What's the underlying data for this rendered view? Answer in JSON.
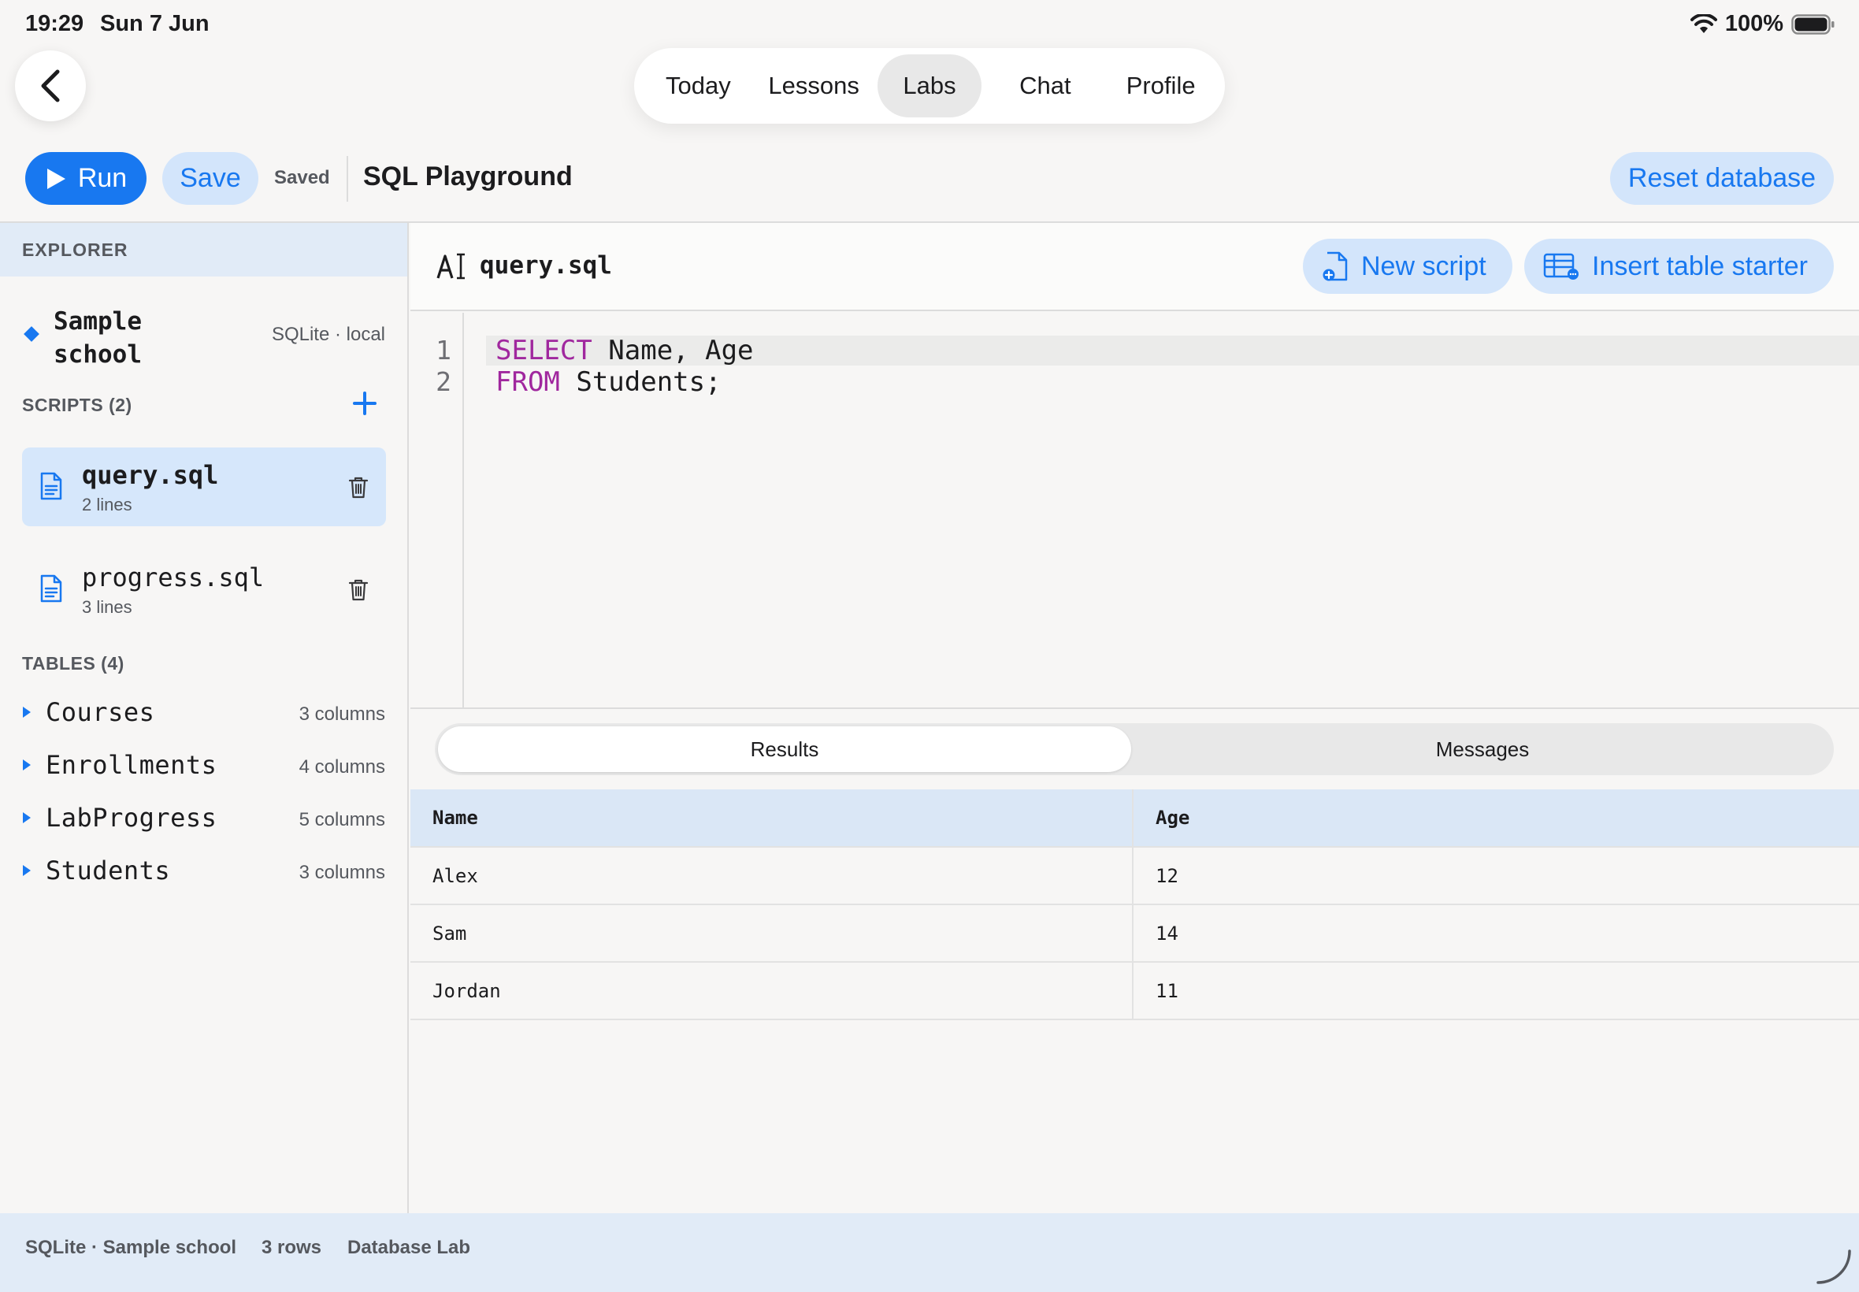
{
  "status_bar": {
    "time": "19:29",
    "date": "Sun 7 Jun",
    "battery": "100%"
  },
  "nav": {
    "tabs": [
      {
        "label": "Today"
      },
      {
        "label": "Lessons"
      },
      {
        "label": "Labs"
      },
      {
        "label": "Chat"
      },
      {
        "label": "Profile"
      }
    ],
    "active_tab": "Labs"
  },
  "toolbar": {
    "run_label": "Run",
    "save_label": "Save",
    "saved_status": "Saved",
    "title": "SQL Playground",
    "reset_label": "Reset database"
  },
  "sidebar": {
    "explorer_label": "EXPLORER",
    "database": {
      "name": "Sample school",
      "meta": "SQLite · local"
    },
    "scripts_label": "SCRIPTS (2)",
    "scripts": [
      {
        "name": "query.sql",
        "lines": "2 lines"
      },
      {
        "name": "progress.sql",
        "lines": "3 lines"
      }
    ],
    "active_script": "query.sql",
    "tables_label": "TABLES (4)",
    "tables": [
      {
        "name": "Courses",
        "columns": "3 columns"
      },
      {
        "name": "Enrollments",
        "columns": "4 columns"
      },
      {
        "name": "LabProgress",
        "columns": "5 columns"
      },
      {
        "name": "Students",
        "columns": "3 columns"
      }
    ]
  },
  "editor": {
    "filename": "query.sql",
    "new_script_label": "New script",
    "insert_starter_label": "Insert table starter",
    "lines": [
      {
        "number": "1",
        "keyword": "SELECT",
        "rest": " Name, Age"
      },
      {
        "number": "2",
        "keyword": "FROM",
        "rest": " Students;"
      }
    ]
  },
  "results": {
    "tabs": [
      {
        "label": "Results"
      },
      {
        "label": "Messages"
      }
    ],
    "active_tab": "Results",
    "columns": [
      "Name",
      "Age"
    ],
    "rows": [
      [
        "Alex",
        "12"
      ],
      [
        "Sam",
        "14"
      ],
      [
        "Jordan",
        "11"
      ]
    ]
  },
  "footer": {
    "engine": "SQLite · Sample school",
    "row_count": "3 rows",
    "app_name": "Database Lab"
  },
  "colors": {
    "accent": "#1878f0",
    "accent_soft": "#d3e5fb",
    "keyword": "#a0279e",
    "header_bg": "#e1ebf7"
  }
}
